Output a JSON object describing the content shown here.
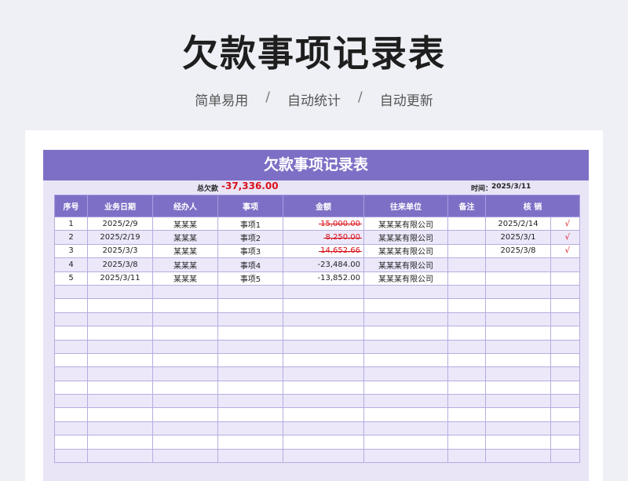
{
  "header": {
    "title": "欠款事项记录表",
    "features": [
      "简单易用",
      "自动统计",
      "自动更新"
    ],
    "separator": "/"
  },
  "sheet": {
    "title": "欠款事项记录表",
    "total_label": "总欠款",
    "total_value": "-37,336.00",
    "time_label": "时间：",
    "time_value": "2025/3/11"
  },
  "table": {
    "columns": [
      "序号",
      "业务日期",
      "经办人",
      "事项",
      "金额",
      "往来单位",
      "备注",
      "核 销"
    ],
    "rows": [
      {
        "no": "1",
        "date": "2025/2/9",
        "handler": "某某某",
        "item": "事项1",
        "amount": "15,000.00",
        "unit": "某某某有限公司",
        "note": "",
        "settle_date": "2025/2/14",
        "check": "√",
        "settled": true
      },
      {
        "no": "2",
        "date": "2025/2/19",
        "handler": "某某某",
        "item": "事项2",
        "amount": "8,250.00",
        "unit": "某某某有限公司",
        "note": "",
        "settle_date": "2025/3/1",
        "check": "√",
        "settled": true
      },
      {
        "no": "3",
        "date": "2025/3/3",
        "handler": "某某某",
        "item": "事项3",
        "amount": "14,652.66",
        "unit": "某某某有限公司",
        "note": "",
        "settle_date": "2025/3/8",
        "check": "√",
        "settled": true
      },
      {
        "no": "4",
        "date": "2025/3/8",
        "handler": "某某某",
        "item": "事项4",
        "amount": "-23,484.00",
        "unit": "某某某有限公司",
        "note": "",
        "settle_date": "",
        "check": "",
        "settled": false
      },
      {
        "no": "5",
        "date": "2025/3/11",
        "handler": "某某某",
        "item": "事项5",
        "amount": "-13,852.00",
        "unit": "某某某有限公司",
        "note": "",
        "settle_date": "",
        "check": "",
        "settled": false
      }
    ],
    "empty_rows": 13
  },
  "colors": {
    "accent": "#7e6fc6",
    "settled_red": "#d9121b",
    "row_alt": "#ece8fa"
  }
}
